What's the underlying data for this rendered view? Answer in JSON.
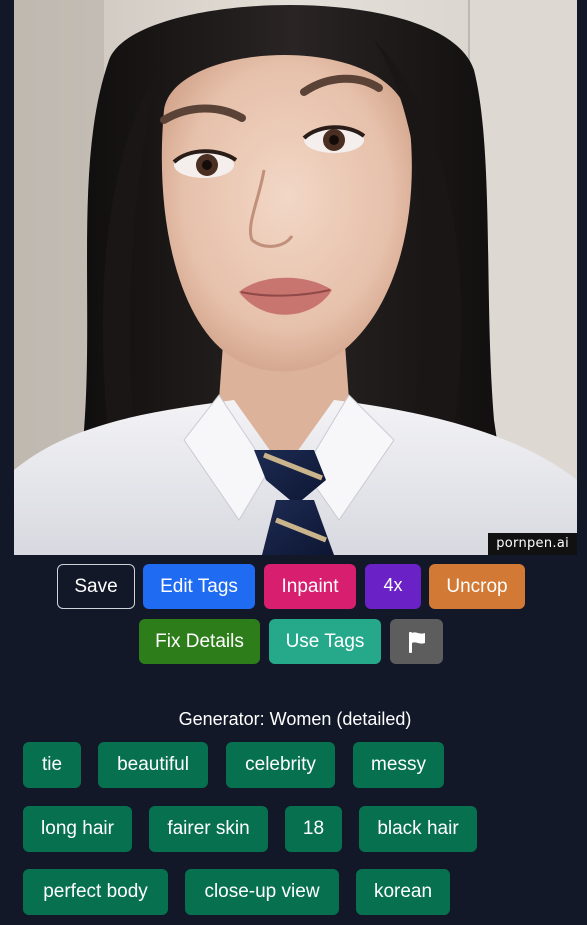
{
  "image": {
    "watermark": "pornpen.ai",
    "subject_icon": "portrait-image"
  },
  "actions": {
    "save": "Save",
    "edit_tags": "Edit Tags",
    "inpaint": "Inpaint",
    "upscale": "4x",
    "uncrop": "Uncrop",
    "fix_details": "Fix Details",
    "use_tags": "Use Tags",
    "flag_icon": "flag-icon"
  },
  "generator": {
    "text": "Generator: Women (detailed)"
  },
  "tags": [
    "tie",
    "beautiful",
    "celebrity",
    "messy",
    "long hair",
    "fairer skin",
    "18",
    "black hair",
    "perfect body",
    "close-up view",
    "korean"
  ],
  "colors": {
    "background": "#121828",
    "save": "#121828",
    "edit_tags": "#1f6bf2",
    "inpaint": "#d81e6f",
    "upscale": "#6a22c7",
    "uncrop": "#d27a35",
    "fix_details": "#2e7d1b",
    "use_tags": "#26a98b",
    "flag": "#5d5d5d",
    "tag": "#07714f"
  }
}
